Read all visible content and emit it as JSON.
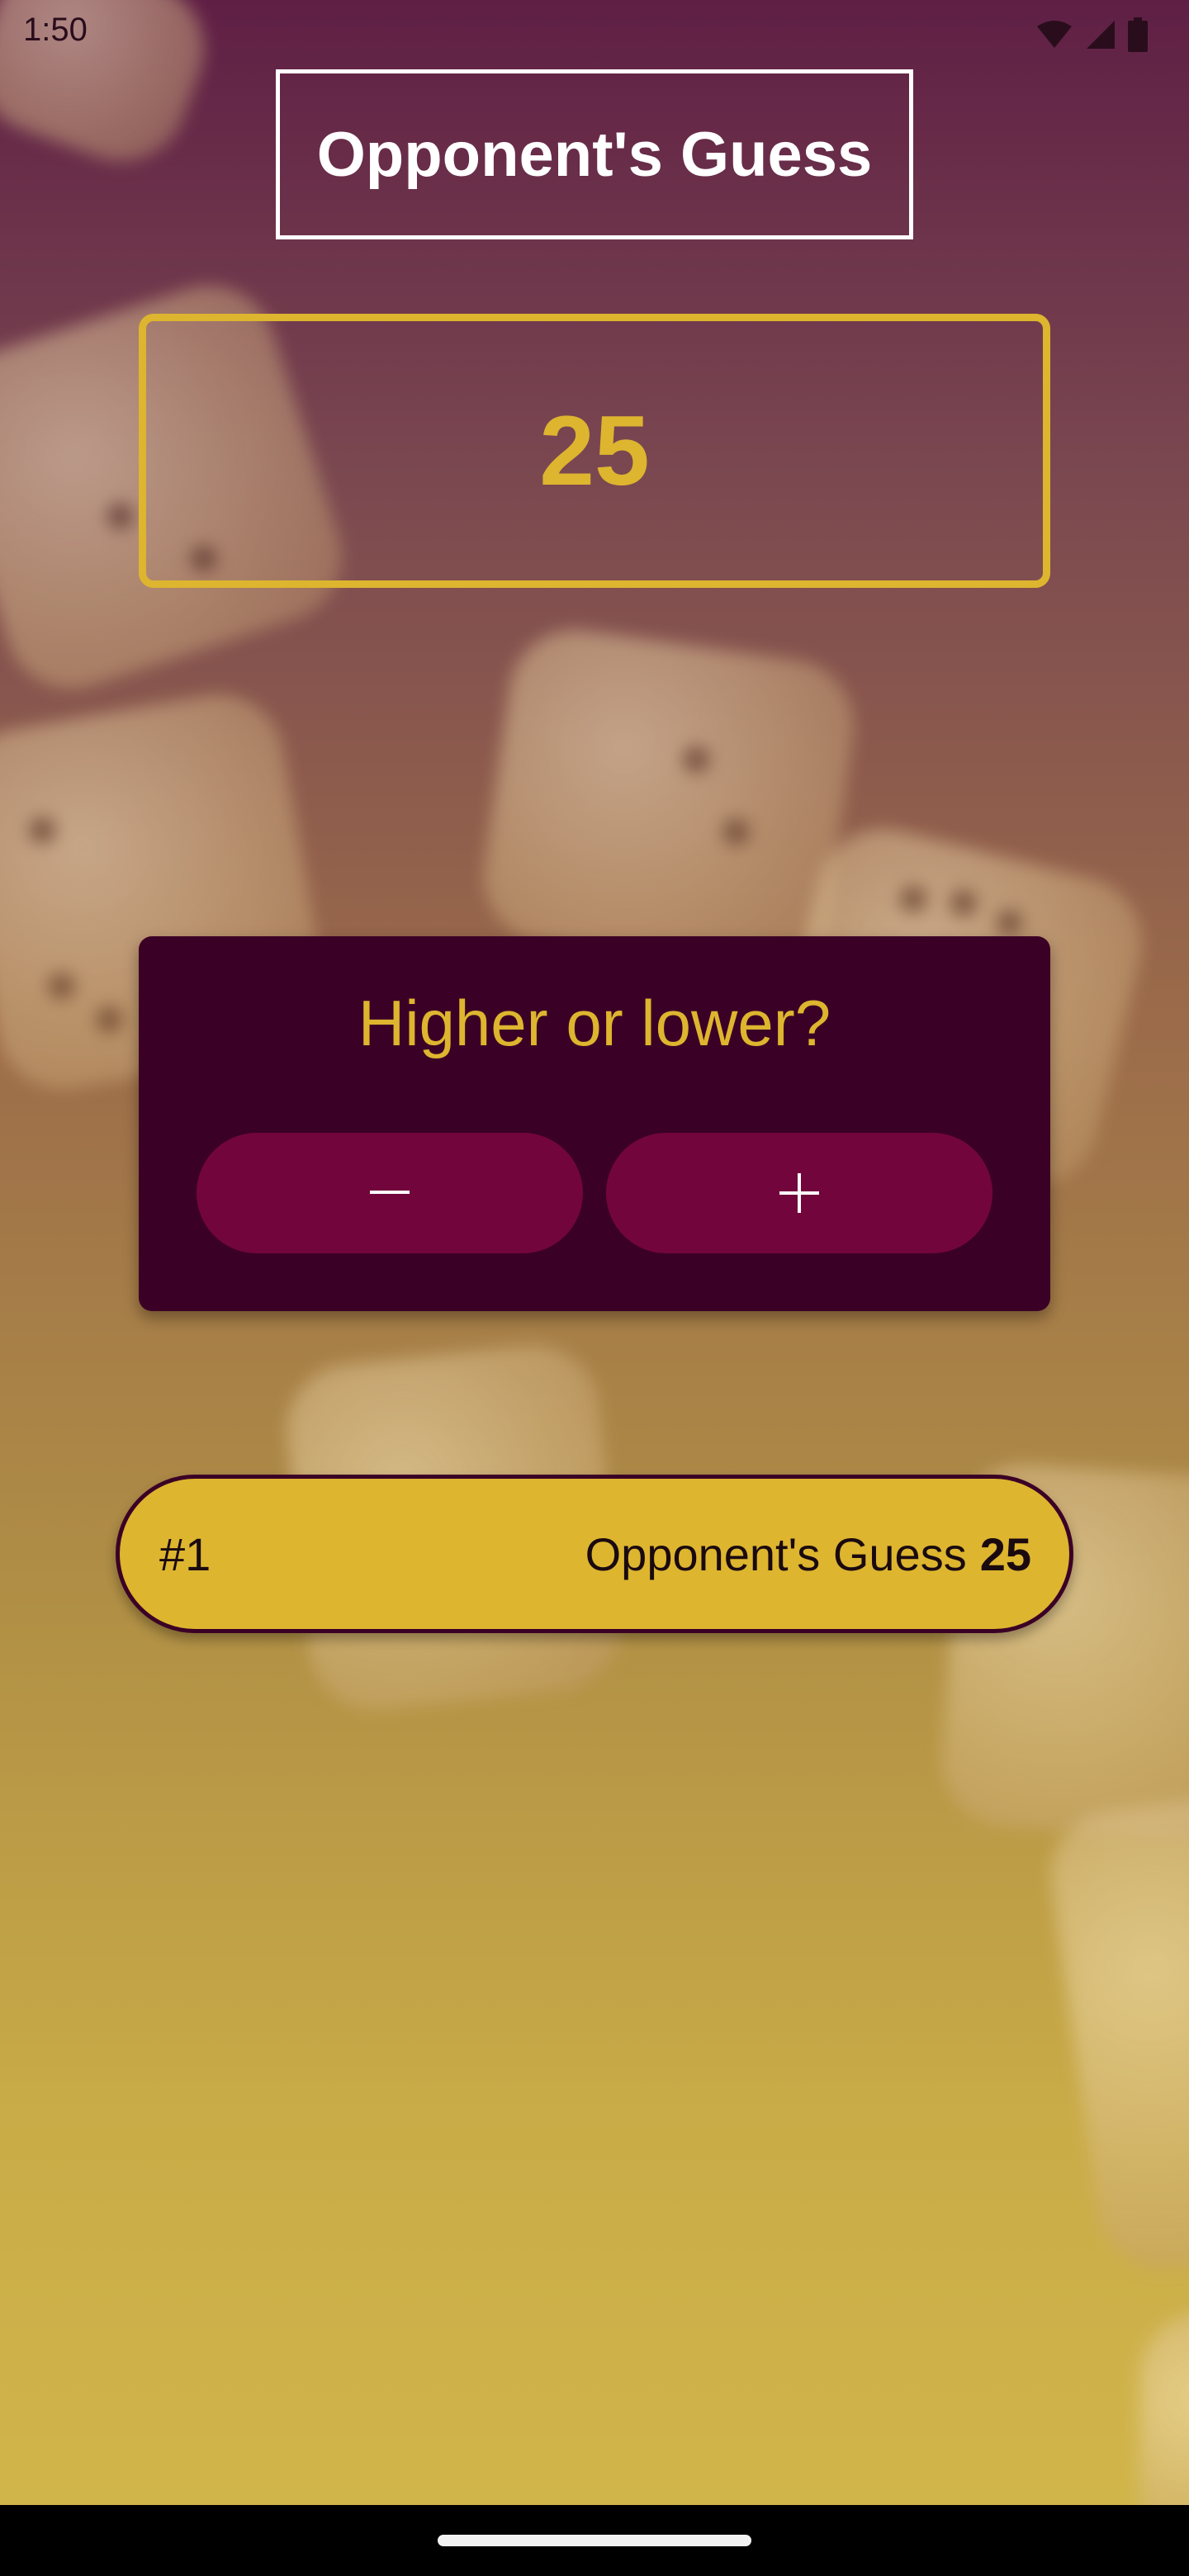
{
  "status_bar": {
    "time": "1:50",
    "icons": [
      "wifi-icon",
      "signal-icon",
      "battery-icon"
    ]
  },
  "screen": {
    "title": "Opponent's Guess",
    "current_guess": "25"
  },
  "prompt_card": {
    "question": "Higher or lower?",
    "lower_button": {
      "icon": "minus-icon",
      "symbol": "−"
    },
    "higher_button": {
      "icon": "plus-icon",
      "symbol": "+"
    }
  },
  "guess_log": [
    {
      "index": "#1",
      "label": "Opponent's Guess",
      "value": "25"
    }
  ],
  "colors": {
    "accent_gold": "#ddb52f",
    "card_dark": "#3b0025",
    "button_maroon": "#72063c",
    "title_white": "#ffffff"
  }
}
